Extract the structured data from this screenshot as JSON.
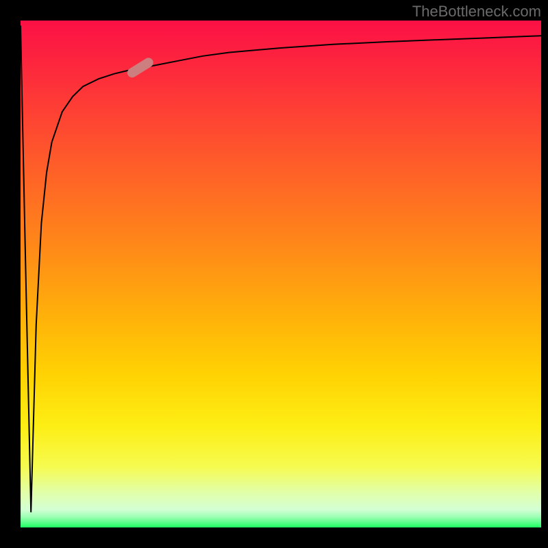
{
  "watermark": "TheBottleneck.com",
  "chart_data": {
    "type": "line",
    "title": "",
    "xlabel": "",
    "ylabel": "",
    "xlim": [
      0,
      100
    ],
    "ylim": [
      0,
      100
    ],
    "x": [
      0,
      1,
      2,
      3,
      4,
      5,
      6,
      8,
      10,
      12,
      15,
      18,
      20,
      23,
      25,
      30,
      35,
      40,
      50,
      60,
      70,
      80,
      90,
      100
    ],
    "y": [
      99,
      50,
      3,
      40,
      60,
      70,
      76,
      82,
      85,
      87,
      88.5,
      89.5,
      90,
      90.7,
      91,
      92,
      93,
      93.7,
      94.6,
      95.3,
      95.8,
      96.2,
      96.6,
      97
    ],
    "marker": {
      "x": 23,
      "y": 90.7
    },
    "background_gradient": {
      "top": "#fb1045",
      "bottom": "#1eff63"
    }
  }
}
